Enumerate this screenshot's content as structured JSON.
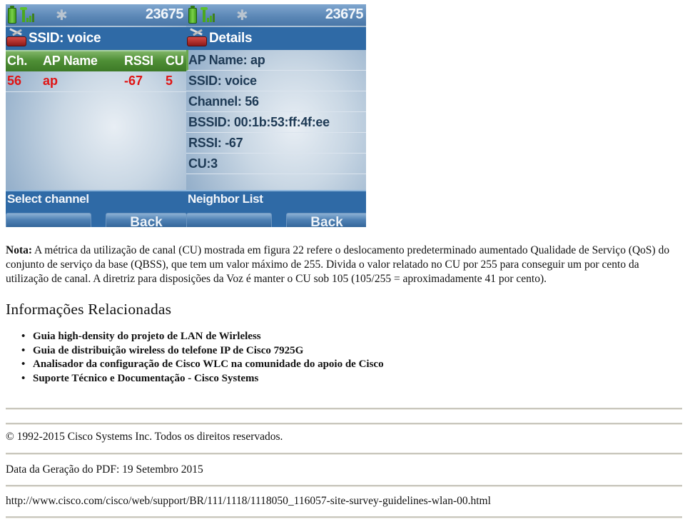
{
  "figure": {
    "left_screen": {
      "status": {
        "battery_icon": "battery-icon",
        "signal_icon": "signal-icon",
        "bluetooth_icon": "bluetooth-icon",
        "extension": "23675"
      },
      "title": "SSID: voice",
      "title_icon": "toolbox-icon",
      "columns": [
        "Ch.",
        "AP Name",
        "RSSI",
        "CU"
      ],
      "rows": [
        {
          "ch": "56",
          "ap_name": "ap",
          "rssi": "-67",
          "cu": "5"
        }
      ],
      "softkey_label": "Select channel",
      "softkeys": [
        "",
        "Back"
      ]
    },
    "right_screen": {
      "status": {
        "battery_icon": "battery-icon",
        "signal_icon": "signal-icon",
        "bluetooth_icon": "bluetooth-icon",
        "extension": "23675"
      },
      "title": "Details",
      "title_icon": "toolbox-icon",
      "details": [
        "AP Name: ap",
        "SSID: voice",
        "Channel: 56",
        "BSSID: 00:1b:53:ff:4f:ee",
        "RSSI: -67",
        "CU:3",
        ""
      ],
      "softkey_label": "Neighbor List",
      "softkeys": [
        "",
        "Back"
      ]
    },
    "colors": {
      "header_blue": "#2f6aa6",
      "column_header_green": "#4f8f36",
      "row_value_red": "#e01414",
      "detail_text": "#1e3a55"
    }
  },
  "note": {
    "label": "Nota:",
    "text": " A métrica da utilização de canal (CU) mostrada em figura 22 refere o deslocamento predeterminado aumentado Qualidade de Serviço (QoS) do conjunto de serviço da base (QBSS), que tem um valor máximo de 255. Divida o valor relatado no CU por 255 para conseguir um por cento da utilização de canal. A diretriz para disposições da Voz é manter o CU sob 105 (105/255 = aproximadamente 41 por cento)."
  },
  "related": {
    "title": "Informações Relacionadas",
    "links": [
      "Guia high-density do projeto de LAN de Wirleless",
      "Guia de distribuição wireless do telefone IP de Cisco 7925G",
      "Analisador da configuração de Cisco WLC na comunidade do apoio de Cisco",
      "Suporte Técnico e Documentação - Cisco Systems"
    ]
  },
  "footer": {
    "copyright": "© 1992-2015 Cisco Systems Inc. Todos os direitos reservados.",
    "pdf_date": "Data da Geração do PDF: 19 Setembro 2015",
    "url": "http://www.cisco.com/cisco/web/support/BR/111/1118/1118050_116057-site-survey-guidelines-wlan-00.html"
  }
}
